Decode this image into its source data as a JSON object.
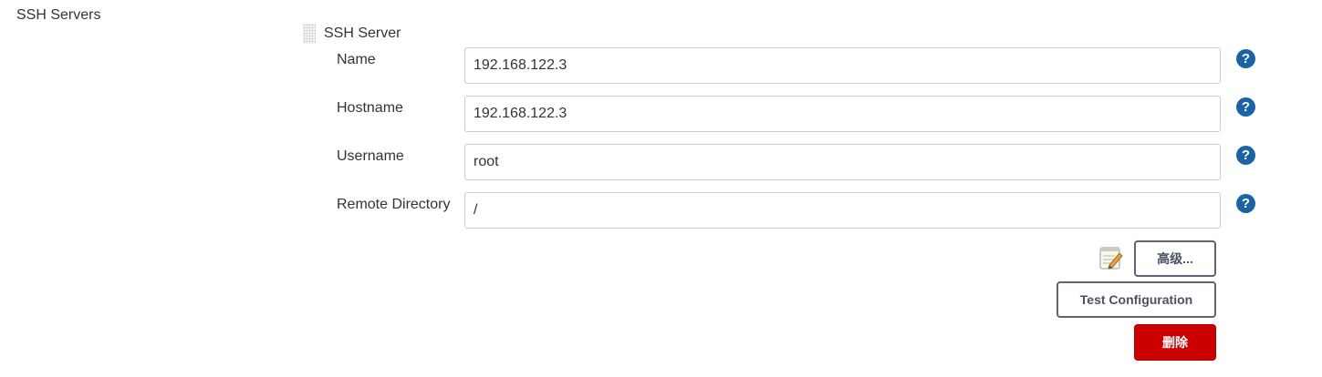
{
  "section": {
    "title": "SSH Servers"
  },
  "server": {
    "title": "SSH Server",
    "fields": [
      {
        "label": "Name",
        "value": "192.168.122.3",
        "help": "?"
      },
      {
        "label": "Hostname",
        "value": "192.168.122.3",
        "help": "?"
      },
      {
        "label": "Username",
        "value": "root",
        "help": "?"
      },
      {
        "label": "Remote Directory",
        "value": "/",
        "help": "?"
      }
    ]
  },
  "actions": {
    "advanced_label": "高级...",
    "test_label": "Test Configuration",
    "delete_label": "删除"
  },
  "colors": {
    "help_icon": "#1a63a5",
    "delete_button": "#cc0000",
    "button_border": "#5a6577"
  },
  "icons": {
    "drag_handle": "drag-handle-icon",
    "help": "help-icon",
    "notepad": "notepad-icon"
  }
}
